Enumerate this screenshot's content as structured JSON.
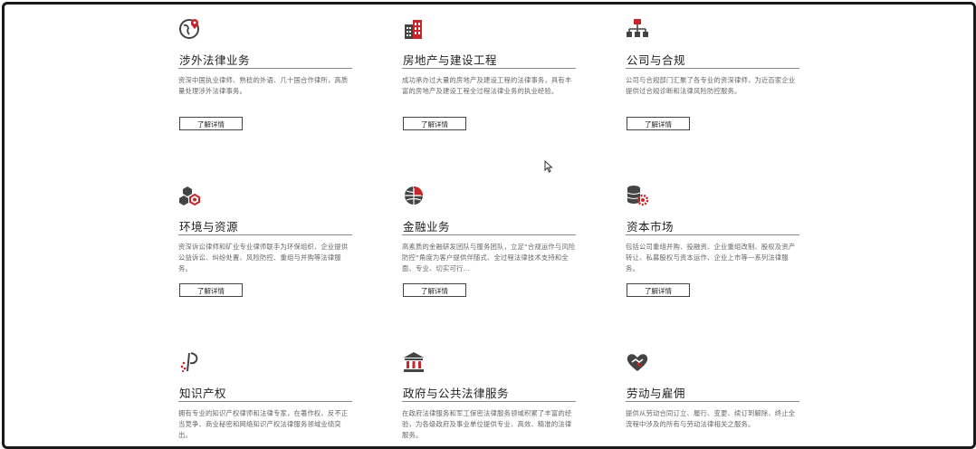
{
  "button_label": "了解详情",
  "accent_color": "#c8262c",
  "cards": [
    {
      "icon": "globe-pin-icon",
      "title": "涉外法律业务",
      "desc": "资深中国执业律师、熟稔的外语、几十国合作律所，高质量处理涉外法律事务。"
    },
    {
      "icon": "building-icon",
      "title": "房地产与建设工程",
      "desc": "成功承办过大量的房地产及建设工程的法律事务，具有丰富的房地产及建设工程全过程法律业务的执业经验。"
    },
    {
      "icon": "org-chart-icon",
      "title": "公司与合规",
      "desc": "公司与合规部门汇聚了各专业的资深律师，为近百家企业提供过合规诊断和法律风险防控服务。"
    },
    {
      "icon": "hexagons-icon",
      "title": "环境与资源",
      "desc": "资深诉讼律师和矿业专业律师联手为环保组织、企业提供公益诉讼、纠纷处置、风险防控、重组与并购等法律服务。"
    },
    {
      "icon": "finance-globe-icon",
      "title": "金融业务",
      "desc": "高素质的金融研发团队与服务团队，立足“合规运作与风险防控”角度为客户提供伴随式、全过程法律技术支持和全面、专业、切实可行..."
    },
    {
      "icon": "coins-gear-icon",
      "title": "资本市场",
      "desc": "包括公司重组并购、投融资、企业重组改制、股权及资产转让、私募股权与资本运作、企业上市等一系列法律服务。"
    },
    {
      "icon": "ip-icon",
      "title": "知识产权",
      "desc": "拥有专业的知识产权律师和法律专家，在著作权、反不正当竞争、商业秘密和网络知识产权法律服务领域业绩突出。"
    },
    {
      "icon": "government-building-icon",
      "title": "政府与公共法律服务",
      "desc": "在政府法律服务和军工保密法律服务领域积累了丰富的经验，为各级政府及事业单位提供专业、高效、精准的法律服务。"
    },
    {
      "icon": "heart-handshake-icon",
      "title": "劳动与雇佣",
      "desc": "提供从劳动合同订立、履行、变更、续订到解除、终止全流程中涉及的所有与劳动法律相关之服务。"
    }
  ]
}
